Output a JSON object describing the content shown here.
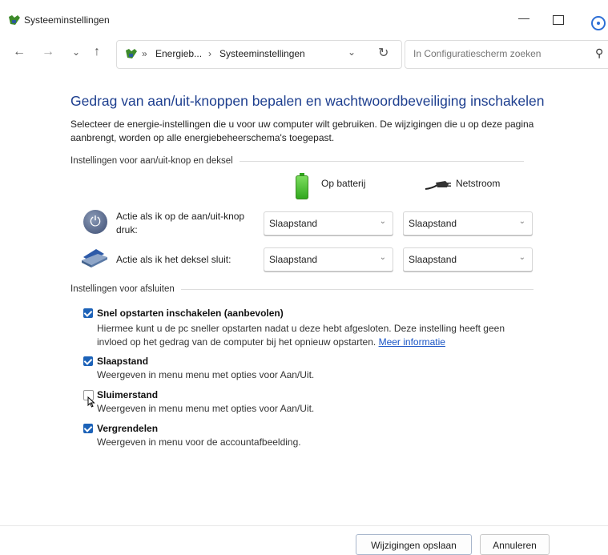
{
  "window": {
    "title": "Systeeminstellingen",
    "minimize": "—"
  },
  "nav": {
    "back": "←",
    "forward": "→",
    "recent": "⌄",
    "up": "↑",
    "breadcrumb_sep": "»",
    "breadcrumb_1": "Energieb...",
    "breadcrumb_arrow": "›",
    "breadcrumb_2": "Systeeminstellingen",
    "dropdown": "⌄",
    "refresh": "↻",
    "search_placeholder": "In Configuratiescherm zoeken",
    "search_icon": "⚲"
  },
  "page": {
    "heading": "Gedrag van aan/uit-knoppen bepalen en wachtwoordbeveiliging inschakelen",
    "intro": "Selecteer de energie-instellingen die u voor uw computer wilt gebruiken. De wijzigingen die u op deze pagina aanbrengt, worden op alle energiebeheerschema's toegepast."
  },
  "power_settings": {
    "section_title": "Instellingen voor aan/uit-knop en deksel",
    "col_battery": "Op batterij",
    "col_plugged": "Netstroom",
    "power_button_label": "Actie als ik op de aan/uit-knop druk:",
    "lid_label": "Actie als ik het deksel sluit:",
    "power_button_battery": "Slaapstand",
    "power_button_plugged": "Slaapstand",
    "lid_battery": "Slaapstand",
    "lid_plugged": "Slaapstand",
    "chevron": "⌄"
  },
  "shutdown_settings": {
    "section_title": "Instellingen voor afsluiten",
    "fast_startup_title": "Snel opstarten inschakelen (aanbevolen)",
    "fast_startup_desc": "Hiermee kunt u de pc sneller opstarten nadat u deze hebt afgesloten. Deze instelling heeft geen invloed op het gedrag van de computer bij het opnieuw opstarten.",
    "more_info": "Meer informatie",
    "sleep_title": "Slaapstand",
    "sleep_desc": "Weergeven in menu menu met opties voor Aan/Uit.",
    "hibernate_title": "Sluimerstand",
    "hibernate_desc": "Weergeven in menu menu met opties voor Aan/Uit.",
    "lock_title": "Vergrendelen",
    "lock_desc": "Weergeven in menu voor de accountafbeelding.",
    "fast_startup_checked": true,
    "sleep_checked": true,
    "hibernate_checked": false,
    "lock_checked": true
  },
  "footer": {
    "save": "Wijzigingen opslaan",
    "cancel": "Annuleren"
  }
}
